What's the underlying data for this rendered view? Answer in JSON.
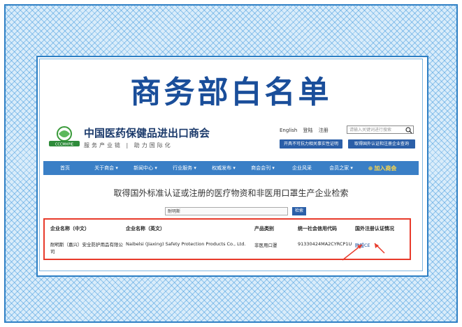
{
  "title": "商务部白名单",
  "site": {
    "logo_text": "CCCMHPIE",
    "org_name": "中国医药保健品进出口商会",
    "slogan": "服务产业链 | 助力国际化",
    "links": [
      "English",
      "登陆",
      "注册"
    ],
    "search_placeholder": "请输入关键词进行搜索",
    "buttons": [
      "开具不可抗力相关事实性证明",
      "取得国外认证和注册企业查询"
    ]
  },
  "nav": [
    "首页",
    "关于商会 ▾",
    "新闻中心 ▾",
    "行业服务 ▾",
    "权威发布 ▾",
    "商会会刊 ▾",
    "企业风采",
    "会员之家 ▾",
    "加入商会"
  ],
  "query": {
    "title": "取得国外标准认证或注册的医疗物资和非医用口罩生产企业检索",
    "input_value": "耐明斯",
    "button": "检索"
  },
  "table": {
    "headers": [
      "企业名称（中文）",
      "企业名称（英文）",
      "产品类别",
      "统一社会信用代码",
      "国外注册认证情况"
    ],
    "row": {
      "cn_name_line1": "耐明斯（嘉兴）安全防护用品有限公",
      "cn_name_line2": "司",
      "en_name": "Naibelsi (Jiaxing) Safety Protection Products Co., Ltd.",
      "category": "非医用口罩",
      "credit_code": "91330424MA2CYRCP1U",
      "cert": "欧盟CE"
    }
  },
  "colors": {
    "frame_blue": "#2e7fc4",
    "title_blue": "#1a4e9a",
    "nav_blue": "#3a7fc6",
    "highlight_red": "#e83a2a"
  }
}
